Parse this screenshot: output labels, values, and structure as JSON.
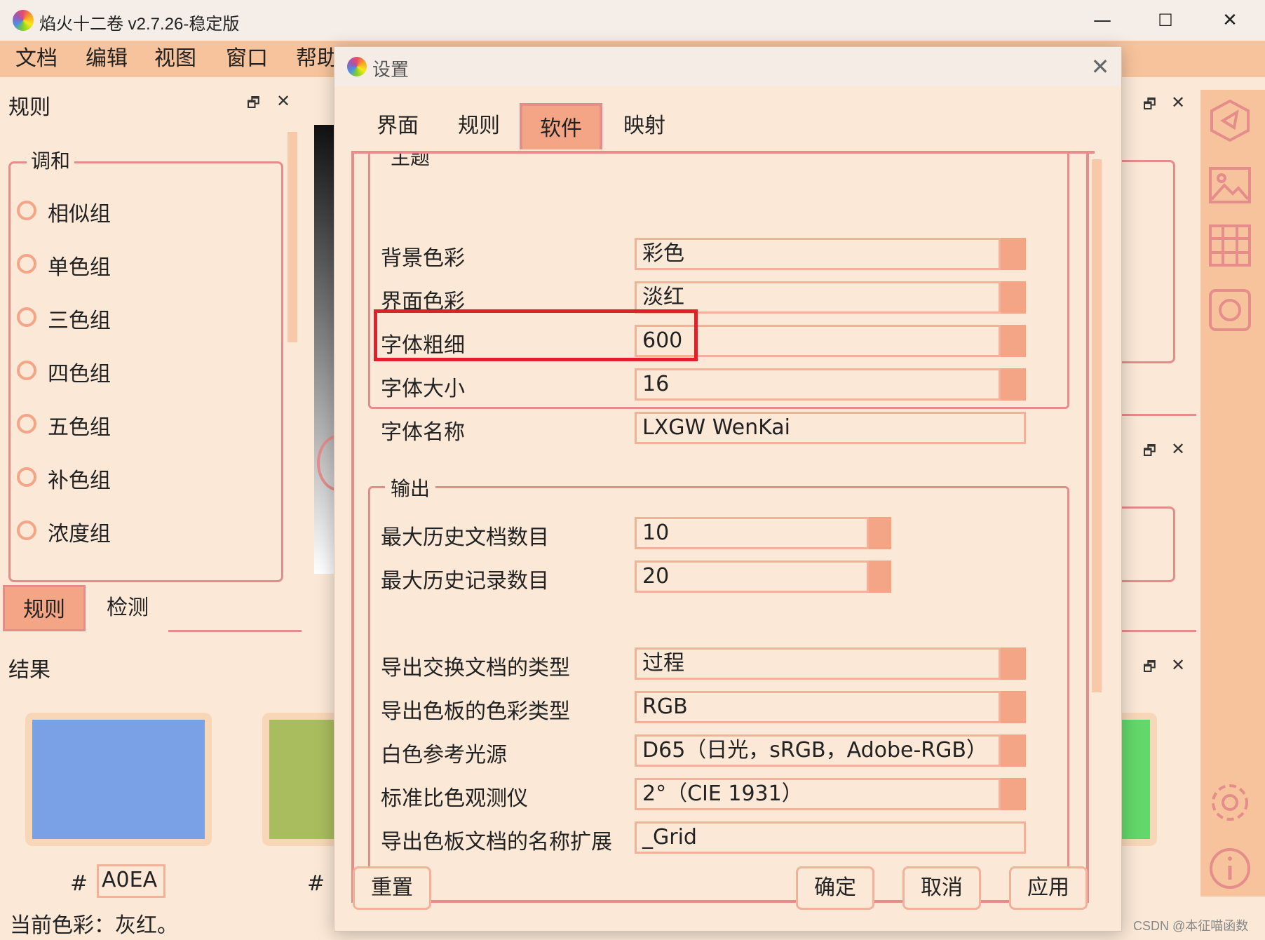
{
  "app": {
    "title": "焰火十二卷 v2.7.26-稳定版"
  },
  "window_controls": {
    "minimize": "—",
    "maximize": "☐",
    "close": "✕"
  },
  "menu": [
    "文档",
    "编辑",
    "视图",
    "窗口",
    "帮助"
  ],
  "left_panel": {
    "title": "规则",
    "group_title": "调和",
    "options": [
      "相似组",
      "单色组",
      "三色组",
      "四色组",
      "五色组",
      "补色组",
      "浓度组"
    ],
    "tabs": [
      "规则",
      "检测"
    ]
  },
  "result_panel": {
    "title": "结果",
    "swatches": [
      {
        "color": "#7aa0e6",
        "hash": "#",
        "hex": "A0EA"
      },
      {
        "color": "#a9bd5f",
        "hash": "#",
        "hex": ""
      }
    ],
    "current_color": "当前色彩：灰红。"
  },
  "dialog": {
    "title": "设置",
    "close": "✕",
    "tabs": [
      "界面",
      "规则",
      "软件",
      "映射"
    ],
    "active_tab": "软件",
    "theme_section": {
      "title": "主题",
      "rows": [
        {
          "label": "背景色彩",
          "value": "彩色"
        },
        {
          "label": "界面色彩",
          "value": "淡红"
        },
        {
          "label": "字体粗细",
          "value": "600"
        },
        {
          "label": "字体大小",
          "value": "16"
        },
        {
          "label": "字体名称",
          "value": "LXGW WenKai"
        }
      ]
    },
    "output_section": {
      "title": "输出",
      "rows": [
        {
          "label": "最大历史文档数目",
          "value": "10"
        },
        {
          "label": "最大历史记录数目",
          "value": "20"
        },
        {
          "label": "导出交换文档的类型",
          "value": "过程"
        },
        {
          "label": "导出色板的色彩类型",
          "value": "RGB"
        },
        {
          "label": "白色参考光源",
          "value": "D65（日光，sRGB，Adobe-RGB）"
        },
        {
          "label": "标准比色观测仪",
          "value": "2°（CIE 1931）"
        },
        {
          "label": "导出色板文档的名称扩展",
          "value": "_Grid"
        }
      ]
    },
    "buttons": {
      "reset": "重置",
      "ok": "确定",
      "cancel": "取消",
      "apply": "应用"
    }
  },
  "colors": {
    "accent": "#f3a585",
    "border": "#e48d8b",
    "background": "#fbe8d6",
    "highlight": "#e0202a",
    "menubar": "#f7c39c"
  },
  "watermark": "CSDN @本征喵函数"
}
